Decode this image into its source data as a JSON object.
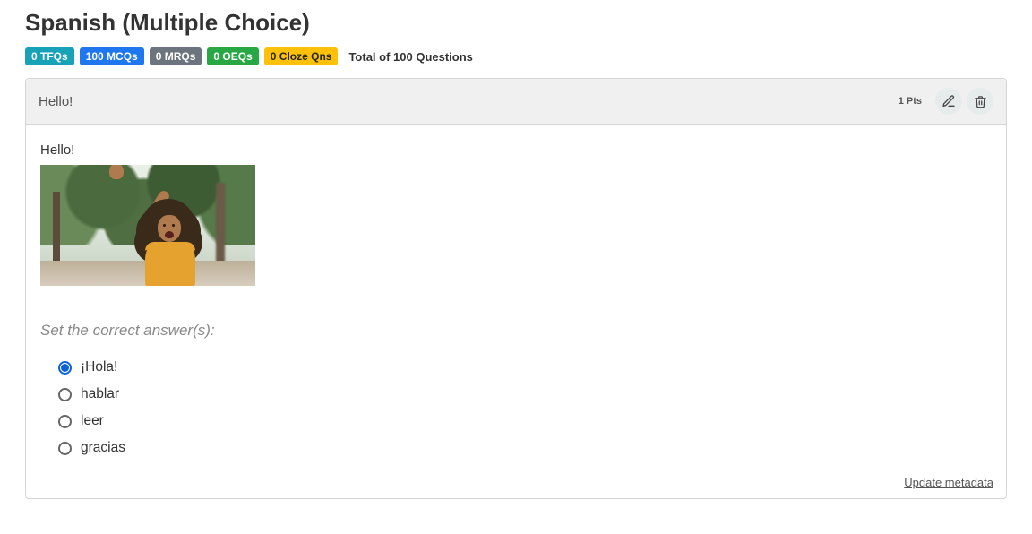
{
  "title": "Spanish (Multiple Choice)",
  "badges": {
    "tfq": "0 TFQs",
    "mcq": "100 MCQs",
    "mrq": "0 MRQs",
    "oeq": "0 OEQs",
    "cloze": "0 Cloze Qns"
  },
  "total": "Total of 100 Questions",
  "question": {
    "header_title": "Hello!",
    "points": "1 Pts",
    "prompt": "Hello!",
    "set_correct_label": "Set the correct answer(s):",
    "options": [
      {
        "label": "¡Hola!",
        "selected": true
      },
      {
        "label": "hablar",
        "selected": false
      },
      {
        "label": "leer",
        "selected": false
      },
      {
        "label": "gracias",
        "selected": false
      }
    ]
  },
  "footer": {
    "update_metadata": "Update metadata"
  }
}
